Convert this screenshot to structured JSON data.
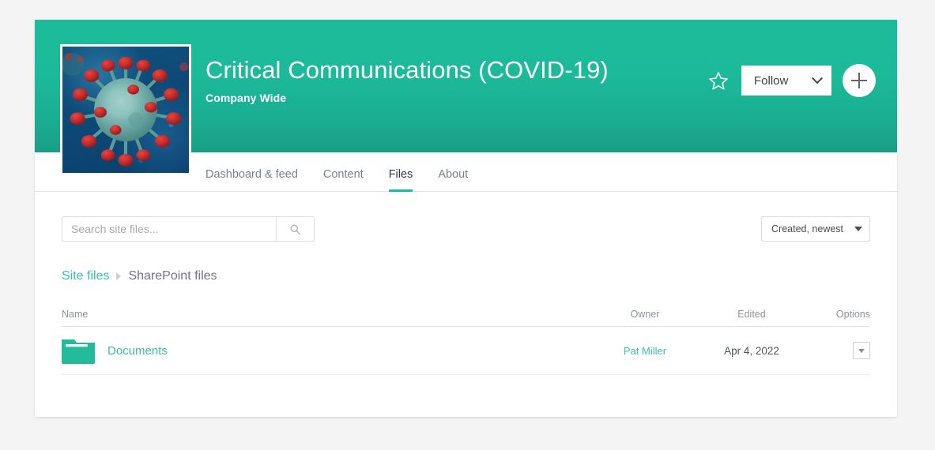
{
  "site": {
    "title": "Critical Communications (COVID-19)",
    "subtitle": "Company Wide",
    "thumbnail_alt": "covid-19-virus-image"
  },
  "banner_actions": {
    "star_icon": "star-outline-icon",
    "follow_label": "Follow",
    "follow_caret_icon": "chevron-down-icon",
    "add_label": "+",
    "add_icon": "plus-icon"
  },
  "tabs": [
    {
      "label": "Dashboard & feed",
      "active": false
    },
    {
      "label": "Content",
      "active": false
    },
    {
      "label": "Files",
      "active": true
    },
    {
      "label": "About",
      "active": false
    }
  ],
  "toolbar": {
    "search_placeholder": "Search site files...",
    "search_value": "",
    "search_icon": "search-icon",
    "sort_label": "Created, newest",
    "sort_caret_icon": "caret-down-icon"
  },
  "breadcrumb": {
    "root": "Site files",
    "separator_icon": "chevron-right-icon",
    "current": "SharePoint files"
  },
  "table": {
    "headers": {
      "name": "Name",
      "owner": "Owner",
      "edited": "Edited",
      "options": "Options"
    },
    "rows": [
      {
        "icon": "folder-icon",
        "name": "Documents",
        "owner": "Pat Miller",
        "edited": "Apr 4, 2022",
        "options_icon": "caret-down-icon"
      }
    ]
  },
  "colors": {
    "accent_teal": "#1dbd9c",
    "link_teal": "#3bbfa2",
    "banner_top": "#1cbc9b",
    "banner_bottom": "#1a9e85",
    "page_bg": "#f4f4f4"
  }
}
